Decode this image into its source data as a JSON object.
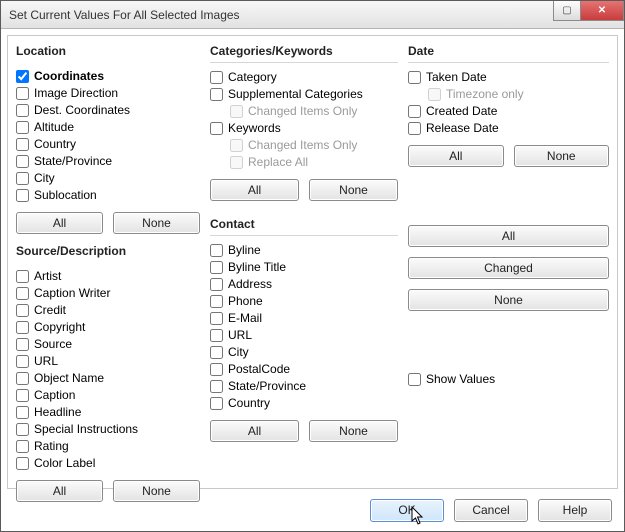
{
  "window": {
    "title": "Set Current Values For All Selected Images"
  },
  "location": {
    "title": "Location",
    "items": [
      {
        "label": "Coordinates",
        "checked": true,
        "bold": true
      },
      {
        "label": "Image Direction"
      },
      {
        "label": "Dest. Coordinates"
      },
      {
        "label": "Altitude"
      },
      {
        "label": "Country"
      },
      {
        "label": "State/Province"
      },
      {
        "label": "City"
      },
      {
        "label": "Sublocation"
      }
    ],
    "all": "All",
    "none": "None"
  },
  "source": {
    "title": "Source/Description",
    "items1": [
      {
        "label": "Artist"
      },
      {
        "label": "Caption Writer"
      },
      {
        "label": "Credit"
      },
      {
        "label": "Copyright"
      },
      {
        "label": "Source"
      },
      {
        "label": "URL"
      }
    ],
    "items2": [
      {
        "label": "Object Name"
      },
      {
        "label": "Caption"
      },
      {
        "label": "Headline"
      },
      {
        "label": "Special Instructions"
      },
      {
        "label": "Rating"
      },
      {
        "label": "Color Label"
      }
    ],
    "all": "All",
    "none": "None"
  },
  "categories": {
    "title": "Categories/Keywords",
    "items": [
      {
        "label": "Category"
      },
      {
        "label": "Supplemental Categories"
      },
      {
        "label": "Changed Items Only",
        "indent": true,
        "dim": true
      },
      {
        "label": "Keywords"
      },
      {
        "label": "Changed Items Only",
        "indent": true,
        "dim": true
      },
      {
        "label": "Replace All",
        "indent": true,
        "dim": true
      }
    ],
    "all": "All",
    "none": "None"
  },
  "contact": {
    "title": "Contact",
    "items": [
      {
        "label": "Byline"
      },
      {
        "label": "Byline Title"
      },
      {
        "label": "Address"
      },
      {
        "label": "Phone"
      },
      {
        "label": "E-Mail"
      },
      {
        "label": "URL"
      },
      {
        "label": "City"
      },
      {
        "label": "PostalCode"
      },
      {
        "label": "State/Province"
      },
      {
        "label": "Country"
      }
    ],
    "all": "All",
    "none": "None"
  },
  "date": {
    "title": "Date",
    "items": [
      {
        "label": "Taken Date"
      },
      {
        "label": "Timezone only",
        "indent": true,
        "dim": true
      },
      {
        "label": "Created Date"
      },
      {
        "label": "Release Date"
      }
    ],
    "all": "All",
    "none": "None"
  },
  "right_buttons": {
    "all": "All",
    "changed": "Changed",
    "none": "None"
  },
  "show_values_label": "Show Values",
  "footer": {
    "ok": "OK",
    "cancel": "Cancel",
    "help": "Help"
  }
}
